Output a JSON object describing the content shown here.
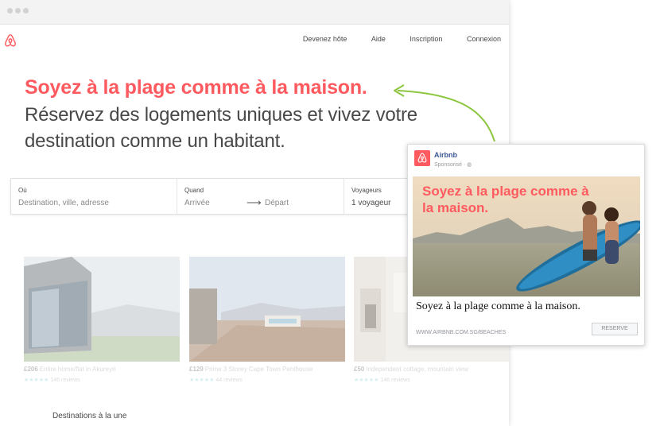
{
  "nav": {
    "links": [
      "Devenez hôte",
      "Aide",
      "Inscription",
      "Connexion"
    ]
  },
  "hero": {
    "title": "Soyez à la plage comme à la maison.",
    "subtitle": "Réservez des logements uniques et vivez votre destination comme un habitant."
  },
  "search": {
    "where_label": "Où",
    "where_placeholder": "Destination, ville, adresse",
    "when_label": "Quand",
    "checkin": "Arrivée",
    "checkout": "Départ",
    "guests_label": "Voyageurs",
    "guests_value": "1 voyageur"
  },
  "listings": [
    {
      "price": "£206",
      "desc": "Entire home/flat in Akureyri",
      "stars": "★★★★★",
      "reviews": "146 reviews"
    },
    {
      "price": "£129",
      "desc": "Prime 3 Storey Cape Town Penthouse",
      "stars": "★★★★★",
      "reviews": "44 reviews"
    },
    {
      "price": "£50",
      "desc": "Independent cottage, mountain view",
      "stars": "★★★★★",
      "reviews": "146 reviews"
    }
  ],
  "featured_title": "Destinations à la une",
  "ad": {
    "brand": "Airbnb",
    "sponsored": "Sponsorisé · ◍",
    "image_headline": "Soyez à la plage comme à la maison.",
    "text": "Soyez à la plage comme à la maison.",
    "url": "WWW.AIRBNB.COM.SG/BEACHES",
    "cta": "RESERVE"
  },
  "colors": {
    "brand": "#ff5a5f",
    "facebook_blue": "#3b5998",
    "arrow_green": "#8cc63f"
  }
}
